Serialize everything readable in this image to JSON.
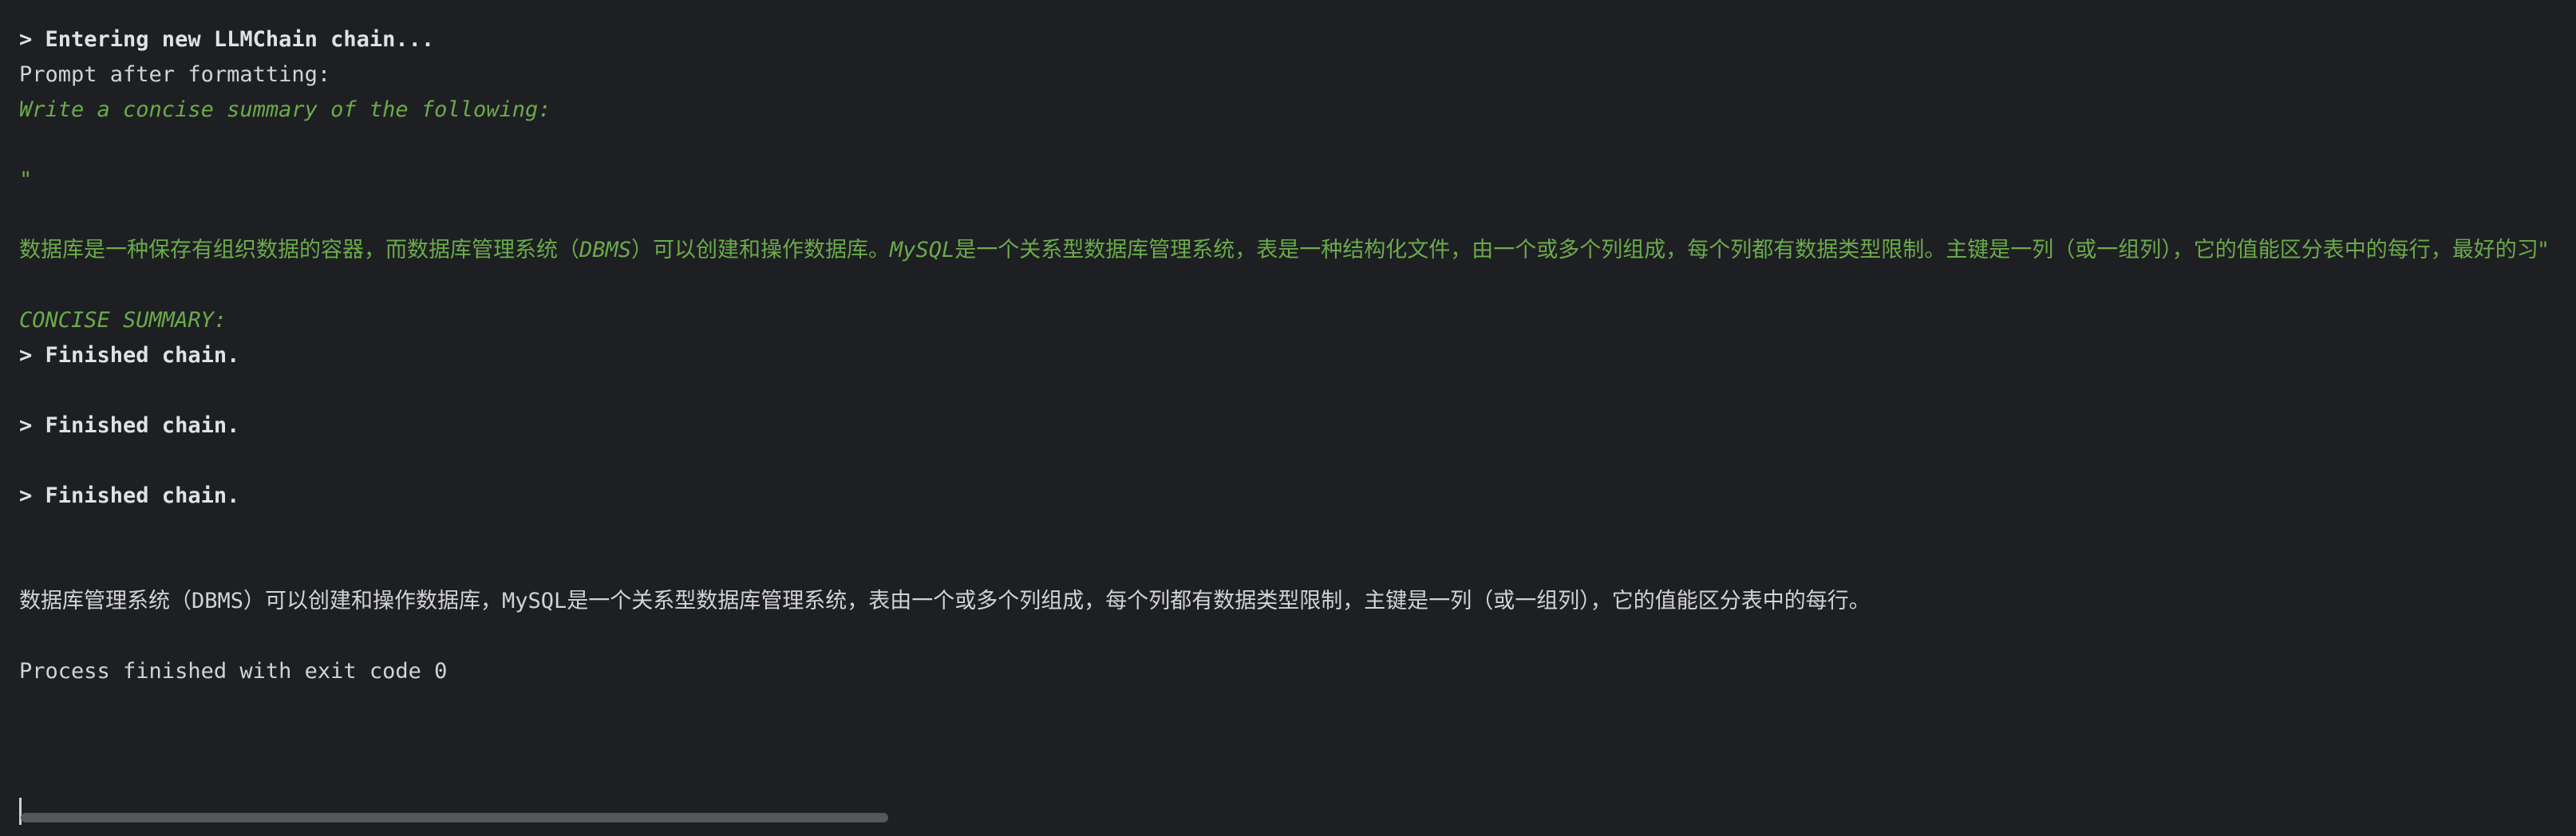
{
  "console": {
    "lines": {
      "entering": "> Entering new LLMChain chain...",
      "prompt_after": "Prompt after formatting:",
      "write_summary": "Write a concise summary of the following:",
      "quote": "\"",
      "chinese_input_a": "数据库是一种保存有组织数据的容器，而数据库管理系统（",
      "chinese_input_dbms": "DBMS",
      "chinese_input_b": "）可以创建和操作数据库。",
      "chinese_input_mysql": "MySQL",
      "chinese_input_c": "是一个关系型数据库管理系统，表是一种结构化文件，由一个或多个列组成，每个列都有数据类型限制。主键是一列（或一组列），它的值能区分表中的每行，最好的习\"",
      "concise_summary": "CONCISE SUMMARY:",
      "finished_1": "> Finished chain.",
      "finished_2": "> Finished chain.",
      "finished_3": "> Finished chain.",
      "result_a": "数据库管理系统（",
      "result_dbms": "DBMS",
      "result_b": "）可以创建和操作数据库，",
      "result_mysql": "MySQL",
      "result_c": "是一个关系型数据库管理系统，表由一个或多个列组成，每个列都有数据类型限制，主键是一列（或一组列），它的值能区分表中的每行。",
      "exit": "Process finished with exit code 0"
    }
  },
  "colors": {
    "background": "#1e1f22",
    "text": "#d2d3d6",
    "prompt_green": "#6aab4b",
    "scrollbar": "#55575c"
  }
}
